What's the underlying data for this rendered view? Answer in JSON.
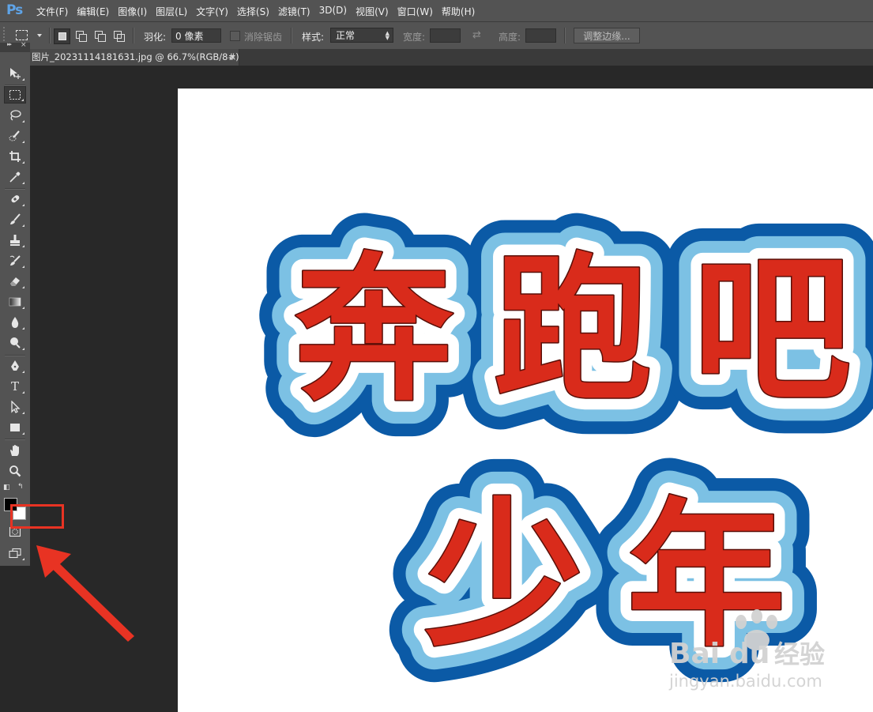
{
  "app": {
    "logo": "Ps"
  },
  "menus": [
    "文件(F)",
    "编辑(E)",
    "图像(I)",
    "图层(L)",
    "文字(Y)",
    "选择(S)",
    "滤镜(T)",
    "3D(D)",
    "视图(V)",
    "窗口(W)",
    "帮助(H)"
  ],
  "options": {
    "feather_label": "羽化:",
    "feather_value": "0 像素",
    "antialias_label": "消除锯齿",
    "style_label": "样式:",
    "style_value": "正常",
    "width_label": "宽度:",
    "height_label": "高度:",
    "refine_edge": "调整边缘..."
  },
  "document": {
    "tab_title": "图片_20231114181631.jpg @ 66.7%(RGB/8#)",
    "close": "×"
  },
  "toolbox": {
    "collapse": "▸▸",
    "close": "×",
    "tools": [
      "move-tool",
      "rectangular-marquee-tool",
      "lasso-tool",
      "quick-selection-tool",
      "crop-tool",
      "eyedropper-tool",
      "spot-healing-brush-tool",
      "brush-tool",
      "clone-stamp-tool",
      "history-brush-tool",
      "eraser-tool",
      "gradient-tool",
      "blur-tool",
      "dodge-tool",
      "pen-tool",
      "type-tool",
      "path-selection-tool",
      "rectangle-tool",
      "hand-tool",
      "zoom-tool"
    ],
    "type_glyph": "T"
  },
  "artwork": {
    "line1": [
      "奔",
      "跑",
      "吧"
    ],
    "line2": [
      "少",
      "年"
    ],
    "fill_color": "#d92b1b",
    "stroke_inner": "#ffffff",
    "stroke_mid": "#7cc1e4",
    "stroke_outer": "#0b5aa6"
  },
  "watermark": {
    "brand_left": "Bai",
    "brand_right": "du",
    "brand_cn": "经验",
    "url": "jingyan.baidu.com"
  },
  "annotation": {
    "color": "#e83323"
  }
}
